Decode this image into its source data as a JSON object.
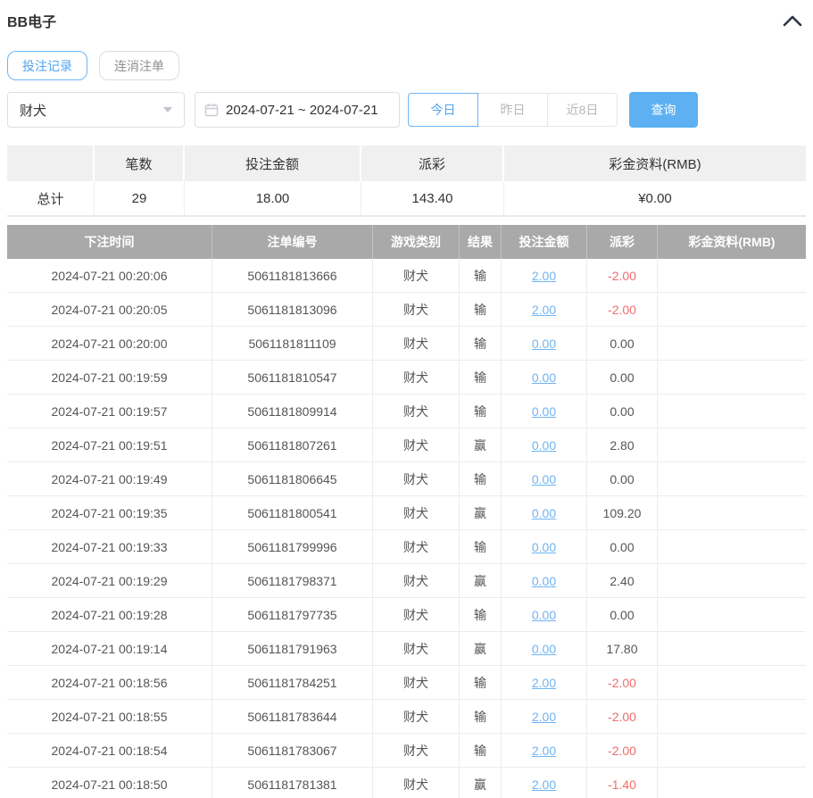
{
  "colors": {
    "accent_blue": "#5db1f2",
    "link_blue": "#6fb4f3",
    "negative_red": "#f16c6c",
    "header_gray": "#a9a9a9"
  },
  "header": {
    "title": "BB电子"
  },
  "tabs": [
    {
      "label": "投注记录",
      "active": true
    },
    {
      "label": "连消注单",
      "active": false
    }
  ],
  "filters": {
    "game_select": {
      "value": "财犬"
    },
    "date_range": {
      "value": "2024-07-21 ~ 2024-07-21"
    },
    "quick_buttons": [
      {
        "label": "今日",
        "active": true
      },
      {
        "label": "昨日",
        "active": false
      },
      {
        "label": "近8日",
        "active": false
      }
    ],
    "query_label": "查询"
  },
  "summary": {
    "headers": [
      "",
      "笔数",
      "投注金额",
      "派彩",
      "彩金资料(RMB)"
    ],
    "row": {
      "label": "总计",
      "count": "29",
      "bet": "18.00",
      "payout": "143.40",
      "bonus": "¥0.00"
    }
  },
  "table": {
    "headers": [
      "下注时间",
      "注单编号",
      "游戏类别",
      "结果",
      "投注金额",
      "派彩",
      "彩金资料(RMB)"
    ],
    "rows": [
      {
        "time": "2024-07-21 00:20:06",
        "order": "5061181813666",
        "game": "财犬",
        "result": "输",
        "bet": "2.00",
        "payout": "-2.00",
        "bonus": ""
      },
      {
        "time": "2024-07-21 00:20:05",
        "order": "5061181813096",
        "game": "财犬",
        "result": "输",
        "bet": "2.00",
        "payout": "-2.00",
        "bonus": ""
      },
      {
        "time": "2024-07-21 00:20:00",
        "order": "5061181811109",
        "game": "财犬",
        "result": "输",
        "bet": "0.00",
        "payout": "0.00",
        "bonus": ""
      },
      {
        "time": "2024-07-21 00:19:59",
        "order": "5061181810547",
        "game": "财犬",
        "result": "输",
        "bet": "0.00",
        "payout": "0.00",
        "bonus": ""
      },
      {
        "time": "2024-07-21 00:19:57",
        "order": "5061181809914",
        "game": "财犬",
        "result": "输",
        "bet": "0.00",
        "payout": "0.00",
        "bonus": ""
      },
      {
        "time": "2024-07-21 00:19:51",
        "order": "5061181807261",
        "game": "财犬",
        "result": "赢",
        "bet": "0.00",
        "payout": "2.80",
        "bonus": ""
      },
      {
        "time": "2024-07-21 00:19:49",
        "order": "5061181806645",
        "game": "财犬",
        "result": "输",
        "bet": "0.00",
        "payout": "0.00",
        "bonus": ""
      },
      {
        "time": "2024-07-21 00:19:35",
        "order": "5061181800541",
        "game": "财犬",
        "result": "赢",
        "bet": "0.00",
        "payout": "109.20",
        "bonus": ""
      },
      {
        "time": "2024-07-21 00:19:33",
        "order": "5061181799996",
        "game": "财犬",
        "result": "输",
        "bet": "0.00",
        "payout": "0.00",
        "bonus": ""
      },
      {
        "time": "2024-07-21 00:19:29",
        "order": "5061181798371",
        "game": "财犬",
        "result": "赢",
        "bet": "0.00",
        "payout": "2.40",
        "bonus": ""
      },
      {
        "time": "2024-07-21 00:19:28",
        "order": "5061181797735",
        "game": "财犬",
        "result": "输",
        "bet": "0.00",
        "payout": "0.00",
        "bonus": ""
      },
      {
        "time": "2024-07-21 00:19:14",
        "order": "5061181791963",
        "game": "财犬",
        "result": "赢",
        "bet": "0.00",
        "payout": "17.80",
        "bonus": ""
      },
      {
        "time": "2024-07-21 00:18:56",
        "order": "5061181784251",
        "game": "财犬",
        "result": "输",
        "bet": "2.00",
        "payout": "-2.00",
        "bonus": ""
      },
      {
        "time": "2024-07-21 00:18:55",
        "order": "5061181783644",
        "game": "财犬",
        "result": "输",
        "bet": "2.00",
        "payout": "-2.00",
        "bonus": ""
      },
      {
        "time": "2024-07-21 00:18:54",
        "order": "5061181783067",
        "game": "财犬",
        "result": "输",
        "bet": "2.00",
        "payout": "-2.00",
        "bonus": ""
      },
      {
        "time": "2024-07-21 00:18:50",
        "order": "5061181781381",
        "game": "财犬",
        "result": "赢",
        "bet": "2.00",
        "payout": "-1.40",
        "bonus": ""
      }
    ]
  }
}
